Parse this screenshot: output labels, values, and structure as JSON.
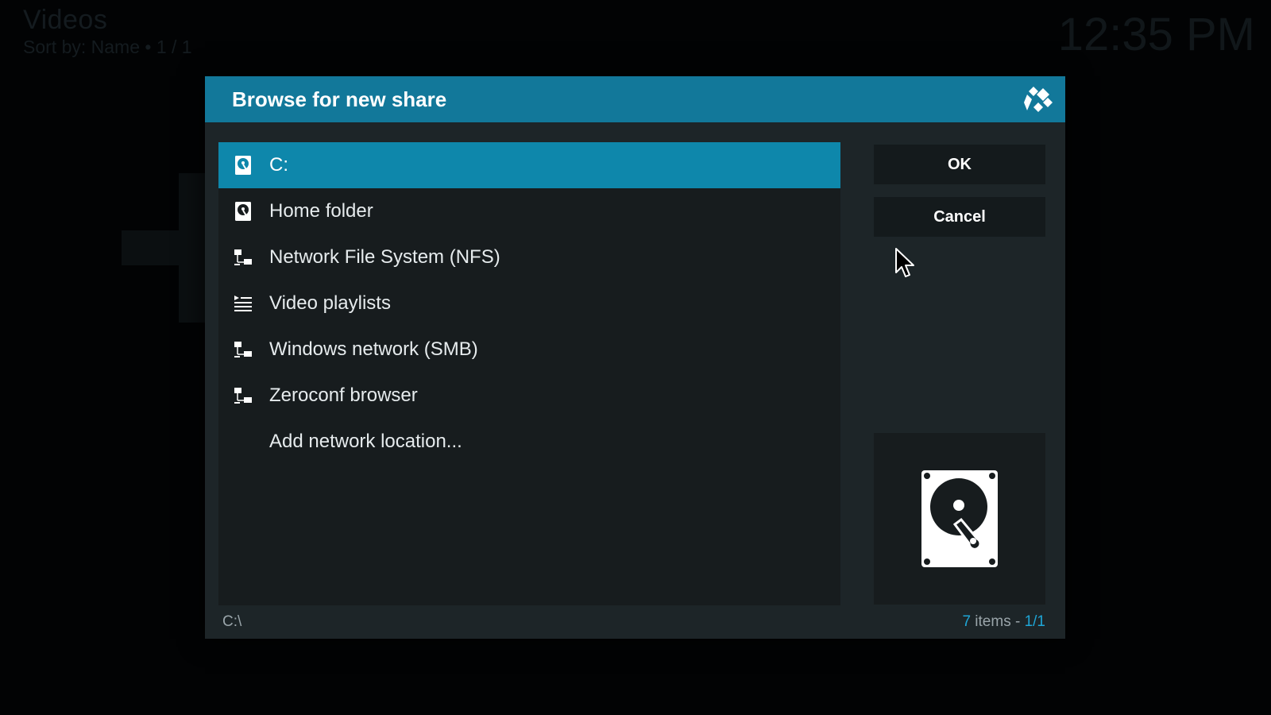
{
  "background": {
    "title": "Videos",
    "subtitle": "Sort by: Name  •  1 / 1",
    "clock": "12:35 PM"
  },
  "dialog": {
    "title": "Browse for new share",
    "items": [
      {
        "label": "C:",
        "icon": "harddisk-icon",
        "selected": true
      },
      {
        "label": "Home folder",
        "icon": "harddisk-icon",
        "selected": false
      },
      {
        "label": "Network File System (NFS)",
        "icon": "network-icon",
        "selected": false
      },
      {
        "label": "Video playlists",
        "icon": "playlist-icon",
        "selected": false
      },
      {
        "label": "Windows network (SMB)",
        "icon": "network-icon",
        "selected": false
      },
      {
        "label": "Zeroconf browser",
        "icon": "network-icon",
        "selected": false
      },
      {
        "label": "Add network location...",
        "icon": "",
        "selected": false
      }
    ],
    "ok_label": "OK",
    "cancel_label": "Cancel",
    "current_path": "C:\\",
    "item_count": "7",
    "item_count_suffix": " items - ",
    "page": "1/1"
  },
  "colors": {
    "header": "#12789a",
    "selection": "#0e87ab",
    "accent": "#1ea5d6",
    "dialog_bg": "#1d2528"
  }
}
